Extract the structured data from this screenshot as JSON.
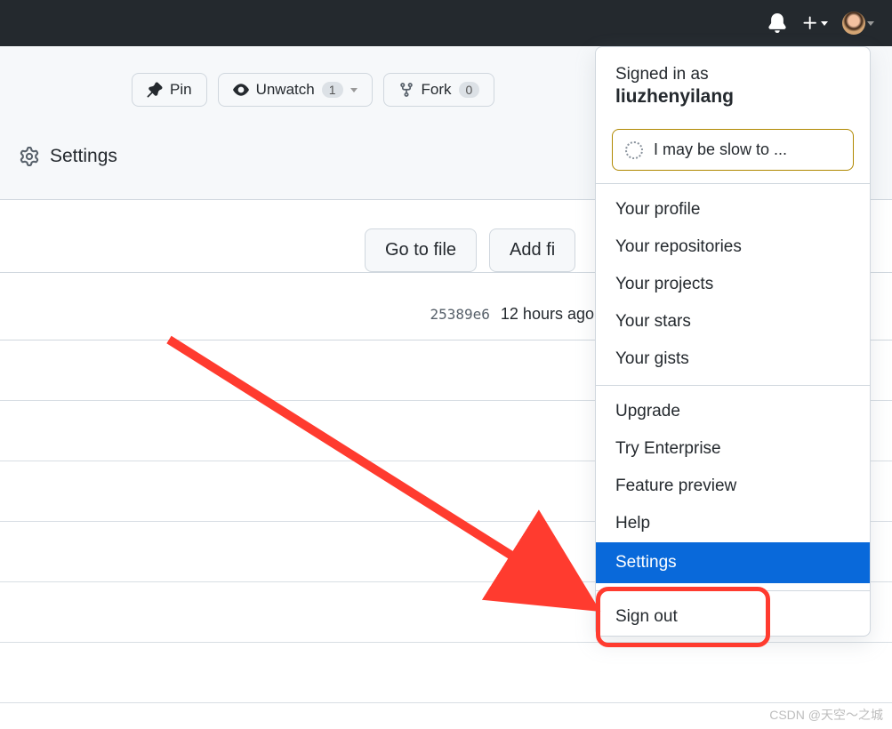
{
  "topbar": {
    "notifications_icon": "bell",
    "add_icon": "plus"
  },
  "actions": {
    "pin_label": "Pin",
    "unwatch_label": "Unwatch",
    "unwatch_count": "1",
    "fork_label": "Fork",
    "fork_count": "0"
  },
  "settings_tab": {
    "label": "Settings"
  },
  "content": {
    "go_to_file": "Go to file",
    "add_file": "Add fi"
  },
  "commit": {
    "hash": "25389e6",
    "time": "12 hours ago"
  },
  "dropdown": {
    "signed_in_prefix": "Signed in as",
    "username": "liuzhenyilang",
    "status_text": "I may be slow to ...",
    "group1": [
      "Your profile",
      "Your repositories",
      "Your projects",
      "Your stars",
      "Your gists"
    ],
    "group2": [
      "Upgrade",
      "Try Enterprise",
      "Feature preview",
      "Help"
    ],
    "settings_item": "Settings",
    "sign_out": "Sign out"
  },
  "watermark": "CSDN @天空～之城"
}
